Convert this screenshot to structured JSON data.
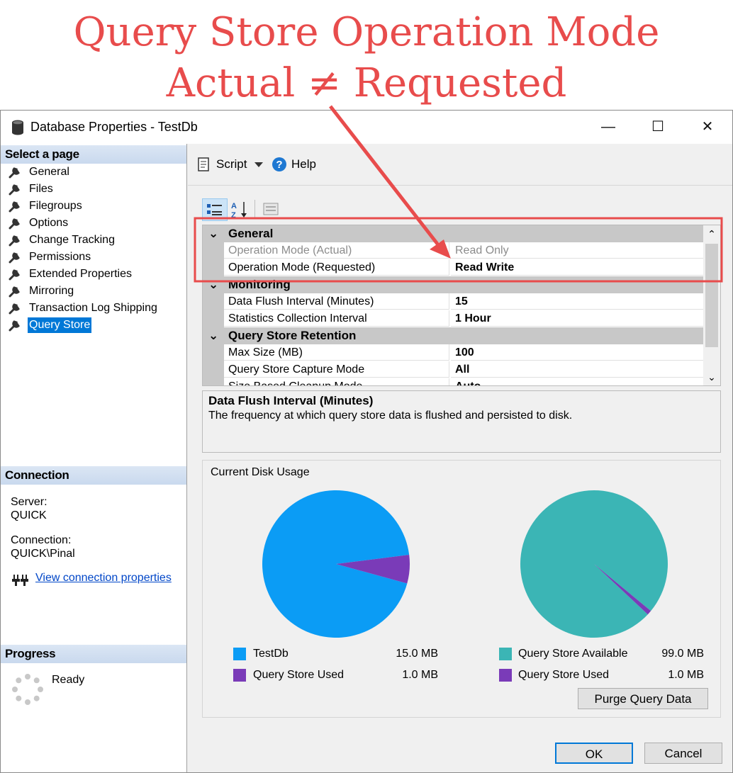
{
  "annotation": {
    "line1": "Query Store Operation Mode",
    "line2": "Actual ≠ Requested",
    "color": "#e84c4c"
  },
  "window": {
    "title": "Database Properties - TestDb",
    "controls": {
      "minimize": "—",
      "maximize": "☐",
      "close": "✕"
    }
  },
  "left_pane": {
    "select_header": "Select a page",
    "pages": [
      {
        "label": "General",
        "icon": "wrench-icon"
      },
      {
        "label": "Files",
        "icon": "wrench-icon"
      },
      {
        "label": "Filegroups",
        "icon": "wrench-icon"
      },
      {
        "label": "Options",
        "icon": "wrench-icon"
      },
      {
        "label": "Change Tracking",
        "icon": "wrench-icon"
      },
      {
        "label": "Permissions",
        "icon": "wrench-icon"
      },
      {
        "label": "Extended Properties",
        "icon": "wrench-icon"
      },
      {
        "label": "Mirroring",
        "icon": "wrench-icon"
      },
      {
        "label": "Transaction Log Shipping",
        "icon": "wrench-icon"
      },
      {
        "label": "Query Store",
        "icon": "wrench-icon",
        "selected": true
      }
    ],
    "connection_header": "Connection",
    "server_label": "Server:",
    "server_value": "QUICK",
    "connection_label": "Connection:",
    "connection_value": "QUICK\\Pinal",
    "view_link": "View connection properties",
    "progress_header": "Progress",
    "progress_status": "Ready"
  },
  "toolbar": {
    "script_label": "Script",
    "help_label": "Help"
  },
  "grid": {
    "categories": [
      {
        "label": "General",
        "rows": [
          {
            "name": "Operation Mode (Actual)",
            "value": "Read Only",
            "dim": true
          },
          {
            "name": "Operation Mode (Requested)",
            "value": "Read Write"
          }
        ]
      },
      {
        "label": "Monitoring",
        "rows": [
          {
            "name": "Data Flush Interval (Minutes)",
            "value": "15"
          },
          {
            "name": "Statistics Collection Interval",
            "value": "1 Hour"
          }
        ]
      },
      {
        "label": "Query Store Retention",
        "rows": [
          {
            "name": "Max Size (MB)",
            "value": "100"
          },
          {
            "name": "Query Store Capture Mode",
            "value": "All"
          },
          {
            "name": "Size Based Cleanup Mode",
            "value": "Auto"
          }
        ]
      }
    ]
  },
  "description": {
    "title": "Data Flush Interval (Minutes)",
    "text": "The frequency at which query store data is flushed and persisted to disk."
  },
  "disk_usage": {
    "title": "Current Disk Usage",
    "chart_data": [
      {
        "type": "pie",
        "slices": [
          {
            "name": "TestDb",
            "value": 15.0,
            "label": "15.0 MB",
            "color": "#0b9cf5"
          },
          {
            "name": "Query Store Used",
            "value": 1.0,
            "label": "1.0 MB",
            "color": "#7a3bb8"
          }
        ]
      },
      {
        "type": "pie",
        "slices": [
          {
            "name": "Query Store Available",
            "value": 99.0,
            "label": "99.0 MB",
            "color": "#3bb5b5"
          },
          {
            "name": "Query Store Used",
            "value": 1.0,
            "label": "1.0 MB",
            "color": "#7a3bb8"
          }
        ]
      }
    ],
    "purge_button": "Purge Query Data"
  },
  "footer": {
    "ok_button": "OK",
    "cancel_button": "Cancel"
  }
}
